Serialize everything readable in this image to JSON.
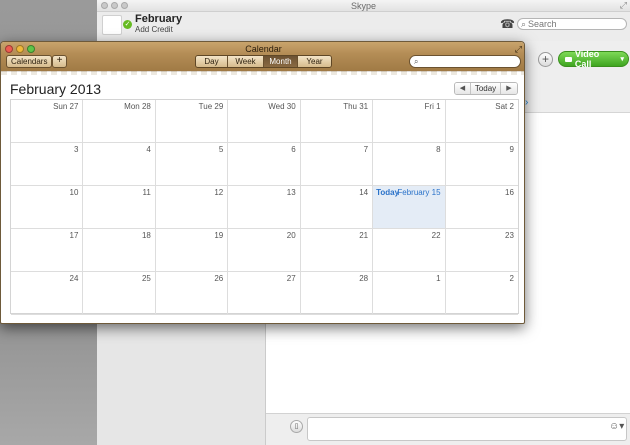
{
  "skype": {
    "title": "Skype",
    "profile": {
      "name": "February",
      "credit": "Add Credit"
    },
    "search_placeholder": "Search",
    "video_call": "Video Call"
  },
  "calendar": {
    "window_title": "Calendar",
    "toolbar": {
      "calendars": "Calendars",
      "add": "+"
    },
    "views": [
      "Day",
      "Week",
      "Month",
      "Year"
    ],
    "active_view": "Month",
    "month_title": "February 2013",
    "nav": {
      "prev": "◀",
      "today": "Today",
      "next": "▶"
    },
    "weeks": [
      [
        "Sun 27",
        "Mon 28",
        "Tue 29",
        "Wed 30",
        "Thu 31",
        "Fri 1",
        "Sat 2"
      ],
      [
        "3",
        "4",
        "5",
        "6",
        "7",
        "8",
        "9"
      ],
      [
        "10",
        "11",
        "12",
        "13",
        "14",
        "February 15",
        "16"
      ],
      [
        "17",
        "18",
        "19",
        "20",
        "21",
        "22",
        "23"
      ],
      [
        "24",
        "25",
        "26",
        "27",
        "28",
        "1",
        "2"
      ]
    ],
    "today_label": "Today",
    "colors": {
      "today_highlight": "#e4ecf6",
      "today_text": "#2a72c9",
      "toolbar": "#b48d56"
    }
  }
}
